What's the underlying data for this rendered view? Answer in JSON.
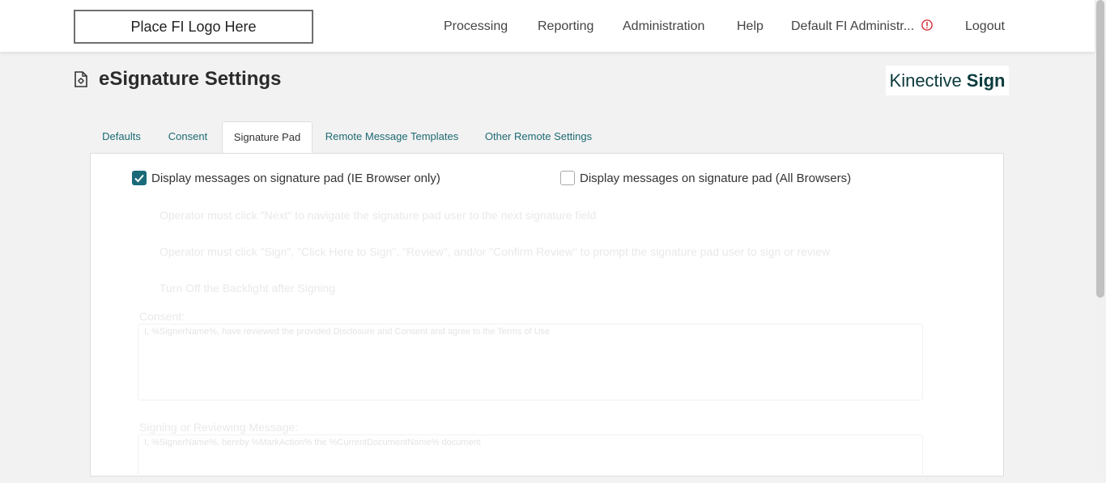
{
  "header": {
    "logo_text": "Place FI Logo Here",
    "nav": {
      "processing": "Processing",
      "reporting": "Reporting",
      "administration": "Administration",
      "help": "Help",
      "user": "Default FI Administr...",
      "logout": "Logout"
    },
    "alert_color": "#d0202e"
  },
  "page": {
    "title": "eSignature Settings",
    "brand_light": "Kinective",
    "brand_bold": "Sign"
  },
  "tabs": {
    "defaults": "Defaults",
    "consent": "Consent",
    "signature_pad": "Signature Pad",
    "remote_templates": "Remote Message Templates",
    "other_remote": "Other Remote Settings",
    "active": "Signature Pad"
  },
  "settings": {
    "ie_only": {
      "label": "Display messages on signature pad (IE Browser only)",
      "checked": true
    },
    "all_browsers": {
      "label": "Display messages on signature pad (All Browsers)",
      "checked": false
    },
    "disabled_options": {
      "next": "Operator must click \"Next\" to navigate the signature pad user to the next signature field",
      "sign": "Operator must click \"Sign\", \"Click Here to Sign\", \"Review\", and/or \"Confirm Review\" to prompt the signature pad user to sign or review",
      "backlight": "Turn Off the Backlight after Signing"
    },
    "consent_label": "Consent:",
    "consent_text": "I, %SignerName%, have reviewed the provided Disclosure and Consent and agree to the Terms of Use",
    "signing_label": "Signing or Reviewing Message:",
    "signing_text": "I, %SignerName%, hereby %MarkAction% the %CurrentDocumentName% document"
  },
  "colors": {
    "accent": "#1a6a79",
    "tab_text": "#1d6a73",
    "brand": "#0b3a3c"
  }
}
